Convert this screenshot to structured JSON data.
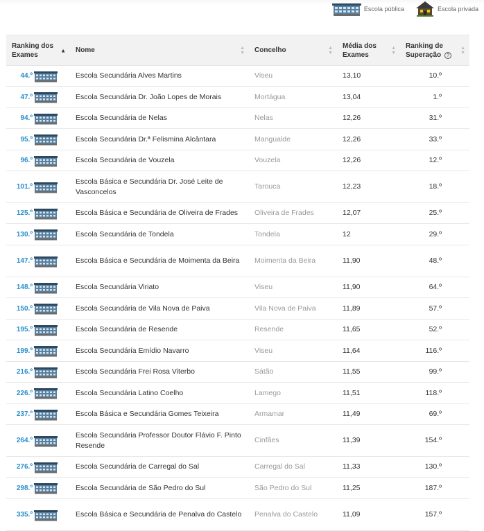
{
  "legend": {
    "public_label": "Escola pública",
    "private_label": "Escola privada",
    "public_icon": "public-school-building-icon",
    "private_icon": "private-school-house-icon"
  },
  "colors": {
    "rank": "#2a8fc9",
    "concelho": "#999999",
    "header_bg": "#f2f2f2"
  },
  "table": {
    "headers": {
      "ranking_exames": "Ranking dos Exames",
      "nome": "Nome",
      "concelho": "Concelho",
      "media": "Média dos Exames",
      "superacao": "Ranking de Superação",
      "help": "?"
    },
    "rows": [
      {
        "rank": "44.º",
        "name": "Escola Secundária Alves Martins",
        "concelho": "Viseu",
        "media": "13,10",
        "sup": "10.º",
        "h": 30
      },
      {
        "rank": "47.º",
        "name": "Escola Secundária Dr. João Lopes de Morais",
        "concelho": "Mortágua",
        "media": "13,04",
        "sup": "1.º",
        "h": 31
      },
      {
        "rank": "94.º",
        "name": "Escola Secundária de Nelas",
        "concelho": "Nelas",
        "media": "12,26",
        "sup": "31.º",
        "h": 30
      },
      {
        "rank": "95.º",
        "name": "Escola Secundária Dr.ª Felismina Alcântara",
        "concelho": "Mangualde",
        "media": "12,26",
        "sup": "33.º",
        "h": 31
      },
      {
        "rank": "96.º",
        "name": "Escola Secundária de Vouzela",
        "concelho": "Vouzela",
        "media": "12,26",
        "sup": "12.º",
        "h": 30
      },
      {
        "rank": "101.º",
        "name": "Escola Básica e Secundária Dr. José Leite de Vasconcelos",
        "concelho": "Tarouca",
        "media": "12,23",
        "sup": "18.º",
        "h": 46
      },
      {
        "rank": "125.º",
        "name": "Escola Básica e Secundária de Oliveira de Frades",
        "concelho": "Oliveira de Frades",
        "media": "12,07",
        "sup": "25.º",
        "h": 30
      },
      {
        "rank": "130.º",
        "name": "Escola Secundária de Tondela",
        "concelho": "Tondela",
        "media": "12",
        "sup": "29.º",
        "h": 31
      },
      {
        "rank": "147.º",
        "name": "Escola Básica e Secundária de Moimenta da Beira",
        "concelho": "Moimenta da Beira",
        "media": "11,90",
        "sup": "48.º",
        "h": 46
      },
      {
        "rank": "148.º",
        "name": "Escola Secundária Viriato",
        "concelho": "Viseu",
        "media": "11,90",
        "sup": "64.º",
        "h": 30
      },
      {
        "rank": "150.º",
        "name": "Escola Secundária de Vila Nova de Paiva",
        "concelho": "Vila Nova de Paiva",
        "media": "11,89",
        "sup": "57.º",
        "h": 31
      },
      {
        "rank": "195.º",
        "name": "Escola Secundária de Resende",
        "concelho": "Resende",
        "media": "11,65",
        "sup": "52.º",
        "h": 30
      },
      {
        "rank": "199.º",
        "name": "Escola Secundária Emídio Navarro",
        "concelho": "Viseu",
        "media": "11,64",
        "sup": "116.º",
        "h": 31
      },
      {
        "rank": "216.º",
        "name": "Escola Secundária Frei Rosa Viterbo",
        "concelho": "Sátão",
        "media": "11,55",
        "sup": "99.º",
        "h": 30
      },
      {
        "rank": "226.º",
        "name": "Escola Secundária Latino Coelho",
        "concelho": "Lamego",
        "media": "11,51",
        "sup": "118.º",
        "h": 31
      },
      {
        "rank": "237.º",
        "name": "Escola Básica e Secundária Gomes Teixeira",
        "concelho": "Armamar",
        "media": "11,49",
        "sup": "69.º",
        "h": 30
      },
      {
        "rank": "264.º",
        "name": "Escola Secundária Professor Doutor Flávio F. Pinto Resende",
        "concelho": "Cinfães",
        "media": "11,39",
        "sup": "154.º",
        "h": 46
      },
      {
        "rank": "276.º",
        "name": "Escola Secundária de Carregal do Sal",
        "concelho": "Carregal do Sal",
        "media": "11,33",
        "sup": "130.º",
        "h": 30
      },
      {
        "rank": "298.º",
        "name": "Escola Secundária de São Pedro do Sul",
        "concelho": "São Pedro do Sul",
        "media": "11,25",
        "sup": "187.º",
        "h": 31
      },
      {
        "rank": "335.º",
        "name": "Escola Básica e Secundária de Penalva do Castelo",
        "concelho": "Penalva do Castelo",
        "media": "11,09",
        "sup": "157.º",
        "h": 46
      }
    ]
  }
}
